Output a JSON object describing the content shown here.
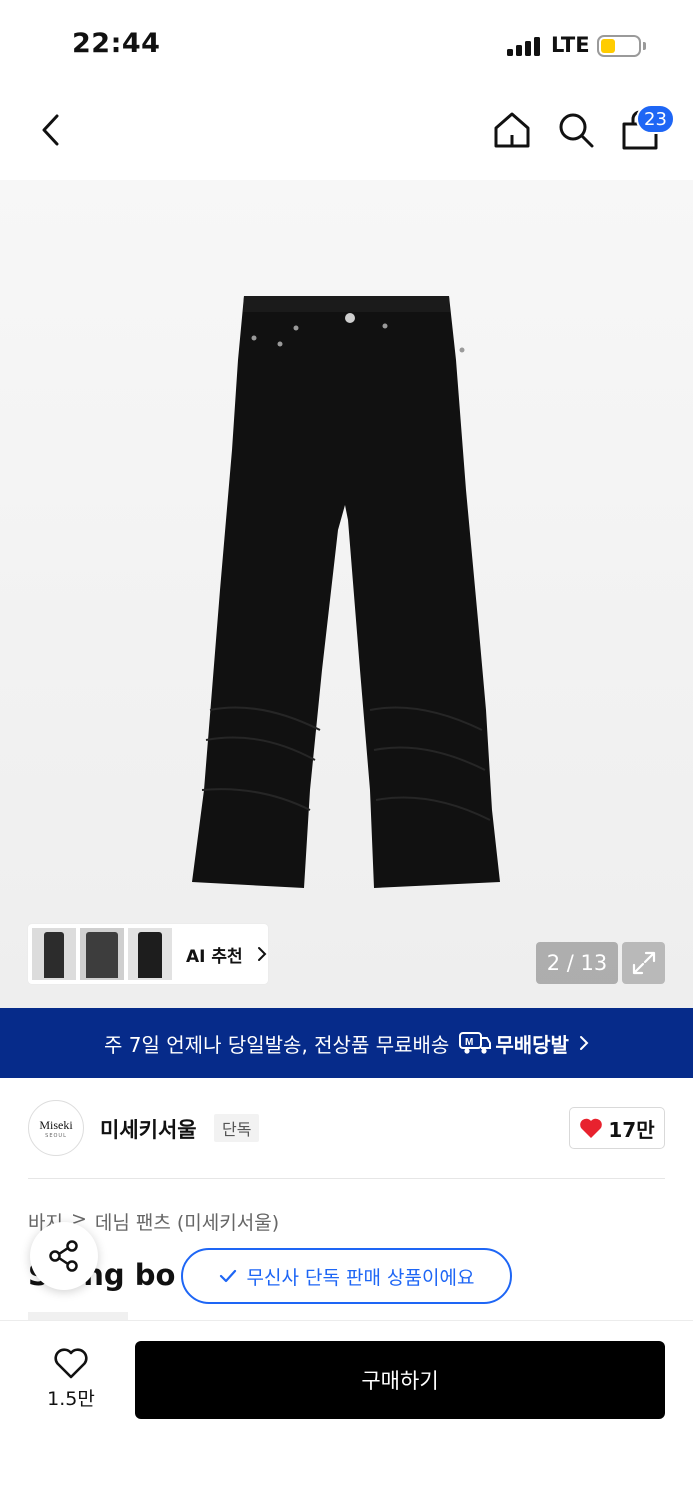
{
  "status_bar": {
    "time": "22:44",
    "network": "LTE"
  },
  "header": {
    "cart_count": "23"
  },
  "gallery": {
    "ai_recommend_label": "AI 추천",
    "image_counter": "2 / 13"
  },
  "banner": {
    "text": "주 7일 언제나 당일발송, 전상품 무료배송",
    "logo_text": "무배당발"
  },
  "brand": {
    "logo_main": "Miseki",
    "logo_sub": "SEOUL",
    "name": "미세키서울",
    "tag": "단독",
    "likes": "17만"
  },
  "product": {
    "breadcrumb": [
      "바지",
      ">",
      "데님 팬츠 (미세키서울)"
    ],
    "title": "S  ring bo"
  },
  "exclusive_notice": "무신사 단독 판매 상품이에요",
  "bottom_bar": {
    "wish_count": "1.5만",
    "buy_label": "구매하기"
  },
  "colors": {
    "accent_blue": "#1e66f5",
    "banner_navy": "#062b8a",
    "heart_red": "#e8222e",
    "battery_yellow": "#ffcc00"
  },
  "icons": [
    "chevron-left-icon",
    "home-icon",
    "search-icon",
    "cart-icon",
    "chevron-right-icon",
    "expand-icon",
    "delivery-truck-icon",
    "heart-filled-icon",
    "share-icon",
    "check-icon",
    "heart-outline-icon"
  ]
}
